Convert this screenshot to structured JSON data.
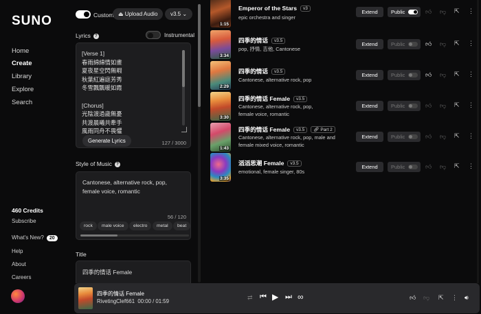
{
  "nav": {
    "logo": "SUNO",
    "items": [
      {
        "label": "Home"
      },
      {
        "label": "Create"
      },
      {
        "label": "Library"
      },
      {
        "label": "Explore"
      },
      {
        "label": "Search"
      }
    ],
    "credits": "460 Credits",
    "subscribe": "Subscribe",
    "whats_new": "What's New?",
    "whats_new_count": "20",
    "help": "Help",
    "about": "About",
    "careers": "Careers"
  },
  "create": {
    "custom_label": "Custom",
    "upload_audio": "Upload Audio",
    "version": "v3.5",
    "lyrics_label": "Lyrics",
    "instrumental_label": "Instrumental",
    "lyrics_text": "[Verse 1]\n春雨綿綿情如畫\n夏夜星空閃無暇\n秋葉紅遍庭芳秀\n冬雪飄飄暖如霞\n\n[Chorus]\n光陰渡過歲無憂\n共渡晨曦共牽手\n風雨同舟不畏懼",
    "generate_lyrics": "Generate Lyrics",
    "lyrics_count": "127 / 3000",
    "style_label": "Style of Music",
    "style_text": "Cantonese, alternative rock, pop, female voice, romantic",
    "style_count": "56 / 120",
    "style_tags": [
      "rock",
      "male voice",
      "electro",
      "metal",
      "beat"
    ],
    "title_label": "Title",
    "title_value": "四季的情话 Female"
  },
  "songs": [
    {
      "title": "Emperor of the Stars",
      "version": "v3",
      "desc": "epic orchestra and singer",
      "duration": "1:15",
      "extend": "Extend",
      "public": "Public",
      "public_on": true,
      "liked": false
    },
    {
      "title": "四季的情话",
      "version": "v3.5",
      "desc": "pop, 抒情, 吉他, Cantonese",
      "duration": "3:34",
      "extend": "Extend",
      "public": "Public",
      "public_on": false,
      "liked": true
    },
    {
      "title": "四季的情话",
      "version": "v3.5",
      "desc": "Cantonese, alternative rock, pop",
      "duration": "2:29",
      "extend": "Extend",
      "public": "Public",
      "public_on": false,
      "liked": true
    },
    {
      "title": "四季的情话 Female",
      "version": "v3.5",
      "desc": "Cantonese, alternative rock, pop, female voice, romantic",
      "duration": "3:30",
      "extend": "Extend",
      "public": "Public",
      "public_on": false,
      "liked": false
    },
    {
      "title": "四季的情话 Female",
      "version": "v3.5",
      "part": "Part 2",
      "desc": "Cantonese, alternative rock, pop, male and female mixed voice, romantic",
      "duration": "1:43",
      "extend": "Extend",
      "public": "Public",
      "public_on": false,
      "liked": false
    },
    {
      "title": "滔滔思潮 Female",
      "version": "v3.5",
      "desc": "emotional, female singer, 80s",
      "duration": "3:35",
      "extend": "Extend",
      "public": "Public",
      "public_on": false,
      "liked": false
    }
  ],
  "player": {
    "title": "四季的情话 Female",
    "artist": "RivetingClef661",
    "time": "00:00 / 01:59"
  },
  "colors": {
    "background": "#0b0b0c",
    "panel": "#1d1d1f",
    "button": "#2b2b2e",
    "player": "#29292c",
    "text": "#e8e8e8"
  }
}
